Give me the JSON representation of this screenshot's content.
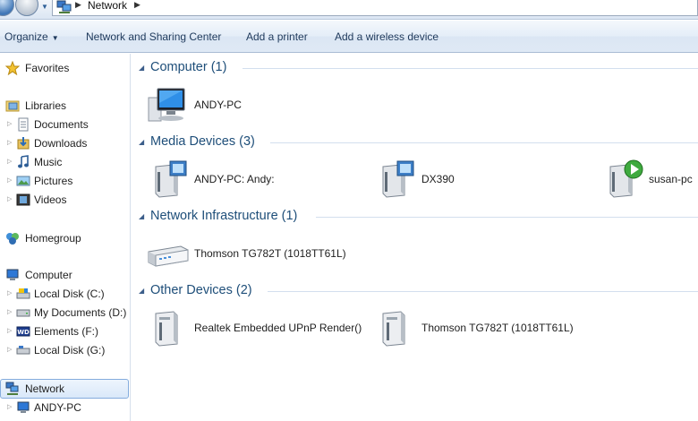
{
  "address": {
    "path": "Network"
  },
  "toolbar": {
    "organize": "Organize",
    "network_sharing_center": "Network and Sharing Center",
    "add_printer": "Add a printer",
    "add_wireless": "Add a wireless device"
  },
  "nav": {
    "favorites": "Favorites",
    "libraries": "Libraries",
    "lib_items": [
      "Documents",
      "Downloads",
      "Music",
      "Pictures",
      "Videos"
    ],
    "homegroup": "Homegroup",
    "computer": "Computer",
    "drives": [
      "Local Disk (C:)",
      "My Documents (D:)",
      "Elements (F:)",
      "Local Disk (G:)"
    ],
    "network": "Network",
    "network_child": "ANDY-PC"
  },
  "groups": [
    {
      "title": "Computer (1)",
      "items": [
        "ANDY-PC"
      ]
    },
    {
      "title": "Media Devices (3)",
      "items": [
        "ANDY-PC: Andy:",
        "DX390",
        "susan-pc"
      ]
    },
    {
      "title": "Network Infrastructure (1)",
      "items": [
        "Thomson TG782T (1018TT61L)"
      ]
    },
    {
      "title": "Other Devices (2)",
      "items": [
        "Realtek Embedded UPnP Render()",
        "Thomson TG782T (1018TT61L)"
      ]
    }
  ],
  "colors": {
    "group_title": "#1e4e79",
    "selection_border": "#84acdd"
  }
}
